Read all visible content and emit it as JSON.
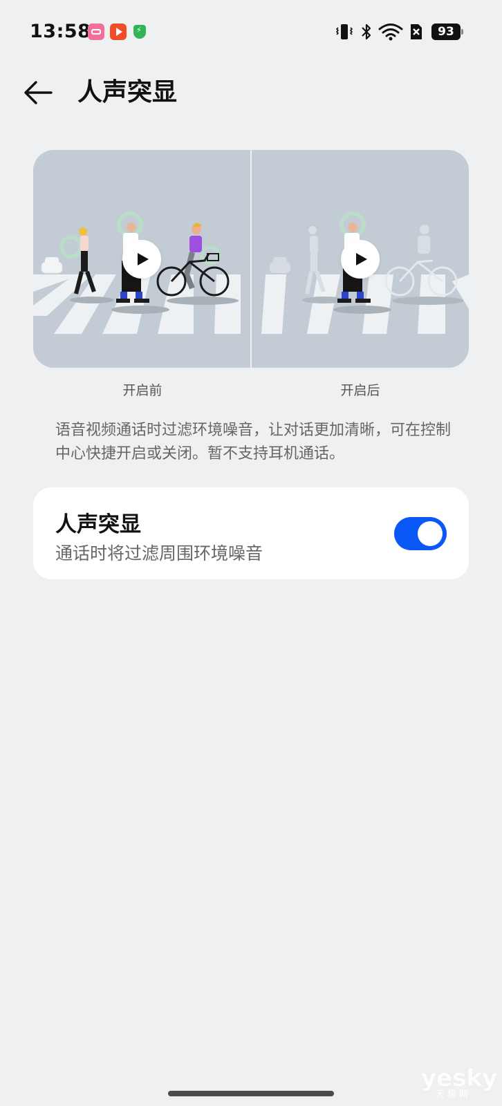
{
  "status_bar": {
    "time": "13:58",
    "battery": "93",
    "icons": [
      "bilibili-app-icon",
      "video-app-icon",
      "security-shield-icon",
      "vibrate-icon",
      "bluetooth-icon",
      "wifi-icon",
      "no-sim-icon",
      "battery-icon"
    ]
  },
  "header": {
    "back_icon": "arrow-left-icon",
    "title": "人声突显"
  },
  "illustration": {
    "before_caption": "开启前",
    "after_caption": "开启后",
    "play_icon": "play-icon"
  },
  "description": "语音视频通话时过滤环境噪音，让对话更加清晰，可在控制中心快捷开启或关闭。暂不支持耳机通话。",
  "setting": {
    "title": "人声突显",
    "subtitle": "通话时将过滤周围环境噪音",
    "enabled": true,
    "accent_color": "#0a59f7"
  },
  "watermark": {
    "brand": "yesky",
    "brand_cn": "天极网"
  }
}
